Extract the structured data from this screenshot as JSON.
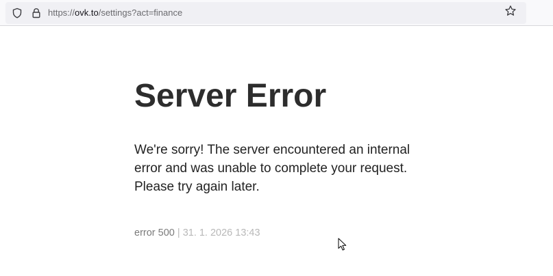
{
  "browser": {
    "url": {
      "scheme": "https://",
      "host": "ovk.to",
      "path": "/settings?act=finance"
    },
    "icons": {
      "tracking_protection": "shield-icon",
      "site_info": "lock-icon",
      "bookmark": "star-icon"
    }
  },
  "page": {
    "title": "Server Error",
    "message": "We're sorry! The server encountered an internal error and was unable to complete your request. Please try again later.",
    "error_code": "error 500",
    "separator": "|",
    "timestamp": "31. 1. 2026 13:43"
  },
  "colors": {
    "title": "#2d2d2d",
    "text": "#222222",
    "muted": "#7a7a7a",
    "faint": "#b8b8b8"
  }
}
